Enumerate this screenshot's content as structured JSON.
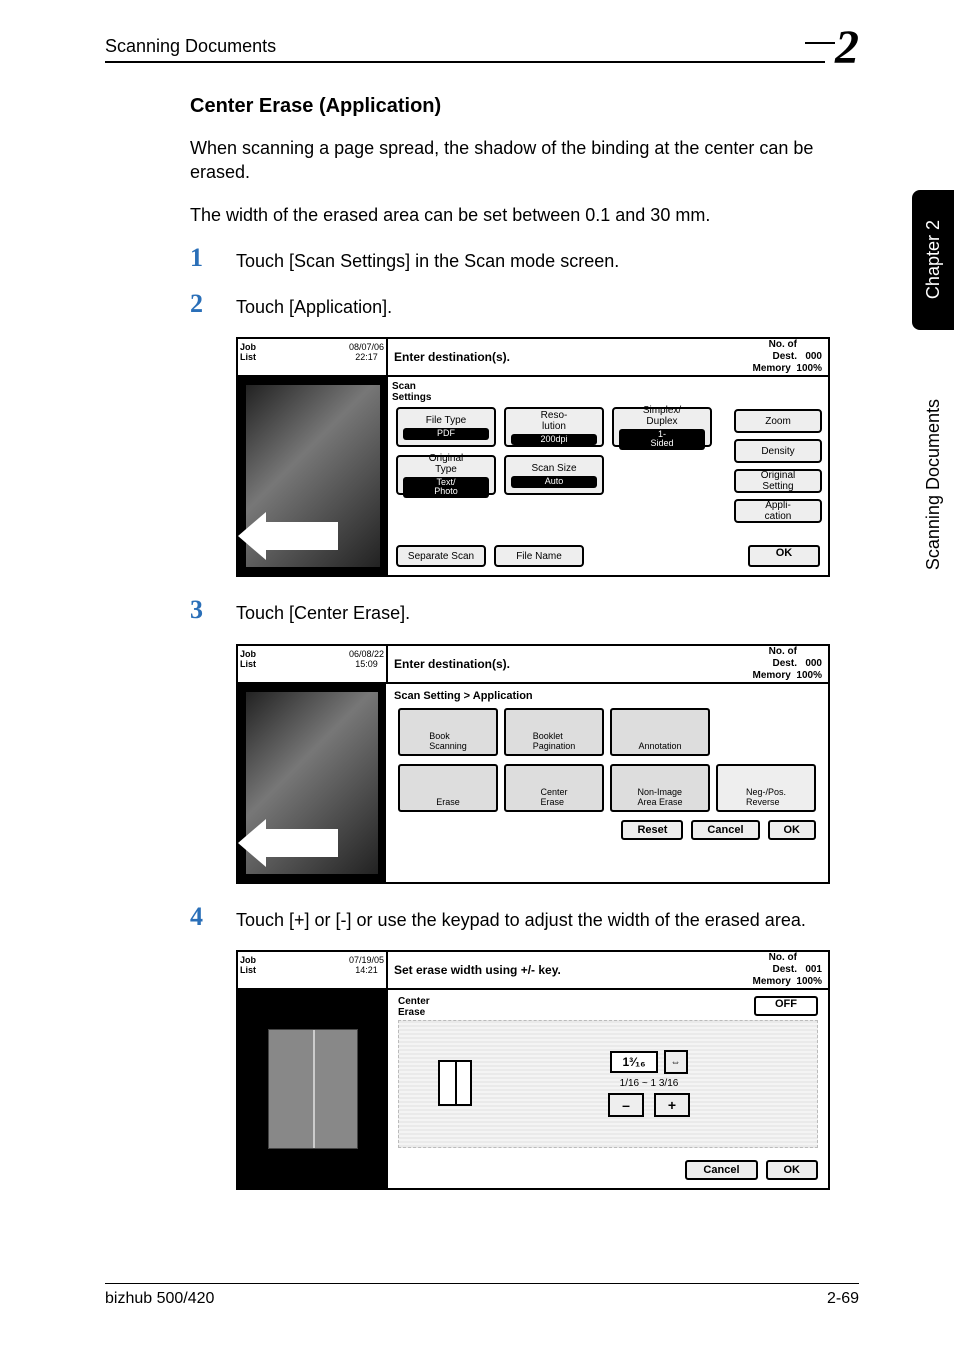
{
  "header": {
    "section": "Scanning Documents",
    "chapter_number": "2"
  },
  "side": {
    "chapter": "Chapter 2",
    "section": "Scanning Documents"
  },
  "body": {
    "heading": "Center Erase (Application)",
    "p1": "When scanning a page spread, the shadow of the binding at the center can be erased.",
    "p2": "The width of the erased area can be set between 0.1 and 30 mm.",
    "steps": {
      "1": {
        "num": "1",
        "text": "Touch [Scan Settings] in the Scan mode screen."
      },
      "2": {
        "num": "2",
        "text": "Touch [Application]."
      },
      "3": {
        "num": "3",
        "text": "Touch [Center Erase]."
      },
      "4": {
        "num": "4",
        "text": "Touch [+] or [-] or use the keypad to adjust the width of the erased area."
      }
    }
  },
  "shot1": {
    "joblist": "Job\nList",
    "datetime": "08/07/06\n22:17",
    "msg": "Enter destination(s).",
    "no_of_dest_lbl": "No. of\nDest.",
    "no_of_dest_val": "000",
    "memory_lbl": "Memory",
    "memory_val": "100%",
    "settings_label": "Scan\nSettings",
    "buttons": {
      "file_type": "File Type",
      "file_type_sub": "PDF",
      "resolution": "Reso-\nlution",
      "resolution_sub": "200dpi",
      "duplex": "Simplex/\nDuplex",
      "duplex_sub": "1-\nSided",
      "original_type": "Original\nType",
      "original_type_sub": "Text/\nPhoto",
      "scan_size": "Scan Size",
      "scan_size_sub": "Auto",
      "separate_scan": "Separate\nScan",
      "file_name": "File\nName",
      "zoom": "Zoom",
      "density": "Density",
      "original_setting": "Original\nSetting",
      "application": "Appli-\ncation",
      "ok": "OK"
    }
  },
  "shot2": {
    "joblist": "Job\nList",
    "datetime": "06/08/22\n15:09",
    "msg": "Enter destination(s).",
    "no_of_dest_lbl": "No. of\nDest.",
    "no_of_dest_val": "000",
    "memory_lbl": "Memory",
    "memory_val": "100%",
    "breadcrumb": "Scan Setting > Application",
    "apps": {
      "book_scanning": "Book\nScanning",
      "booklet_pagination": "Booklet\nPagination",
      "annotation": "Annotation",
      "erase": "Erase",
      "center_erase": "Center\nErase",
      "non_image": "Non-Image\nArea Erase",
      "neg_pos": "Neg-/Pos.\nReverse"
    },
    "reset": "Reset",
    "cancel": "Cancel",
    "ok": "OK"
  },
  "shot3": {
    "joblist": "Job\nList",
    "datetime": "07/19/05\n14:21",
    "msg": "Set erase width using +/- key.",
    "no_of_dest_lbl": "No. of\nDest.",
    "no_of_dest_val": "001",
    "memory_lbl": "Memory",
    "memory_val": "100%",
    "panel_label": "Center\nErase",
    "off": "OFF",
    "value": "1³⁄₁₆",
    "range": "1/16 ~ 1 3/16",
    "swap": "⇔",
    "minus": "–",
    "plus": "+",
    "cancel": "Cancel",
    "ok": "OK"
  },
  "footer": {
    "left": "bizhub 500/420",
    "right": "2-69"
  }
}
